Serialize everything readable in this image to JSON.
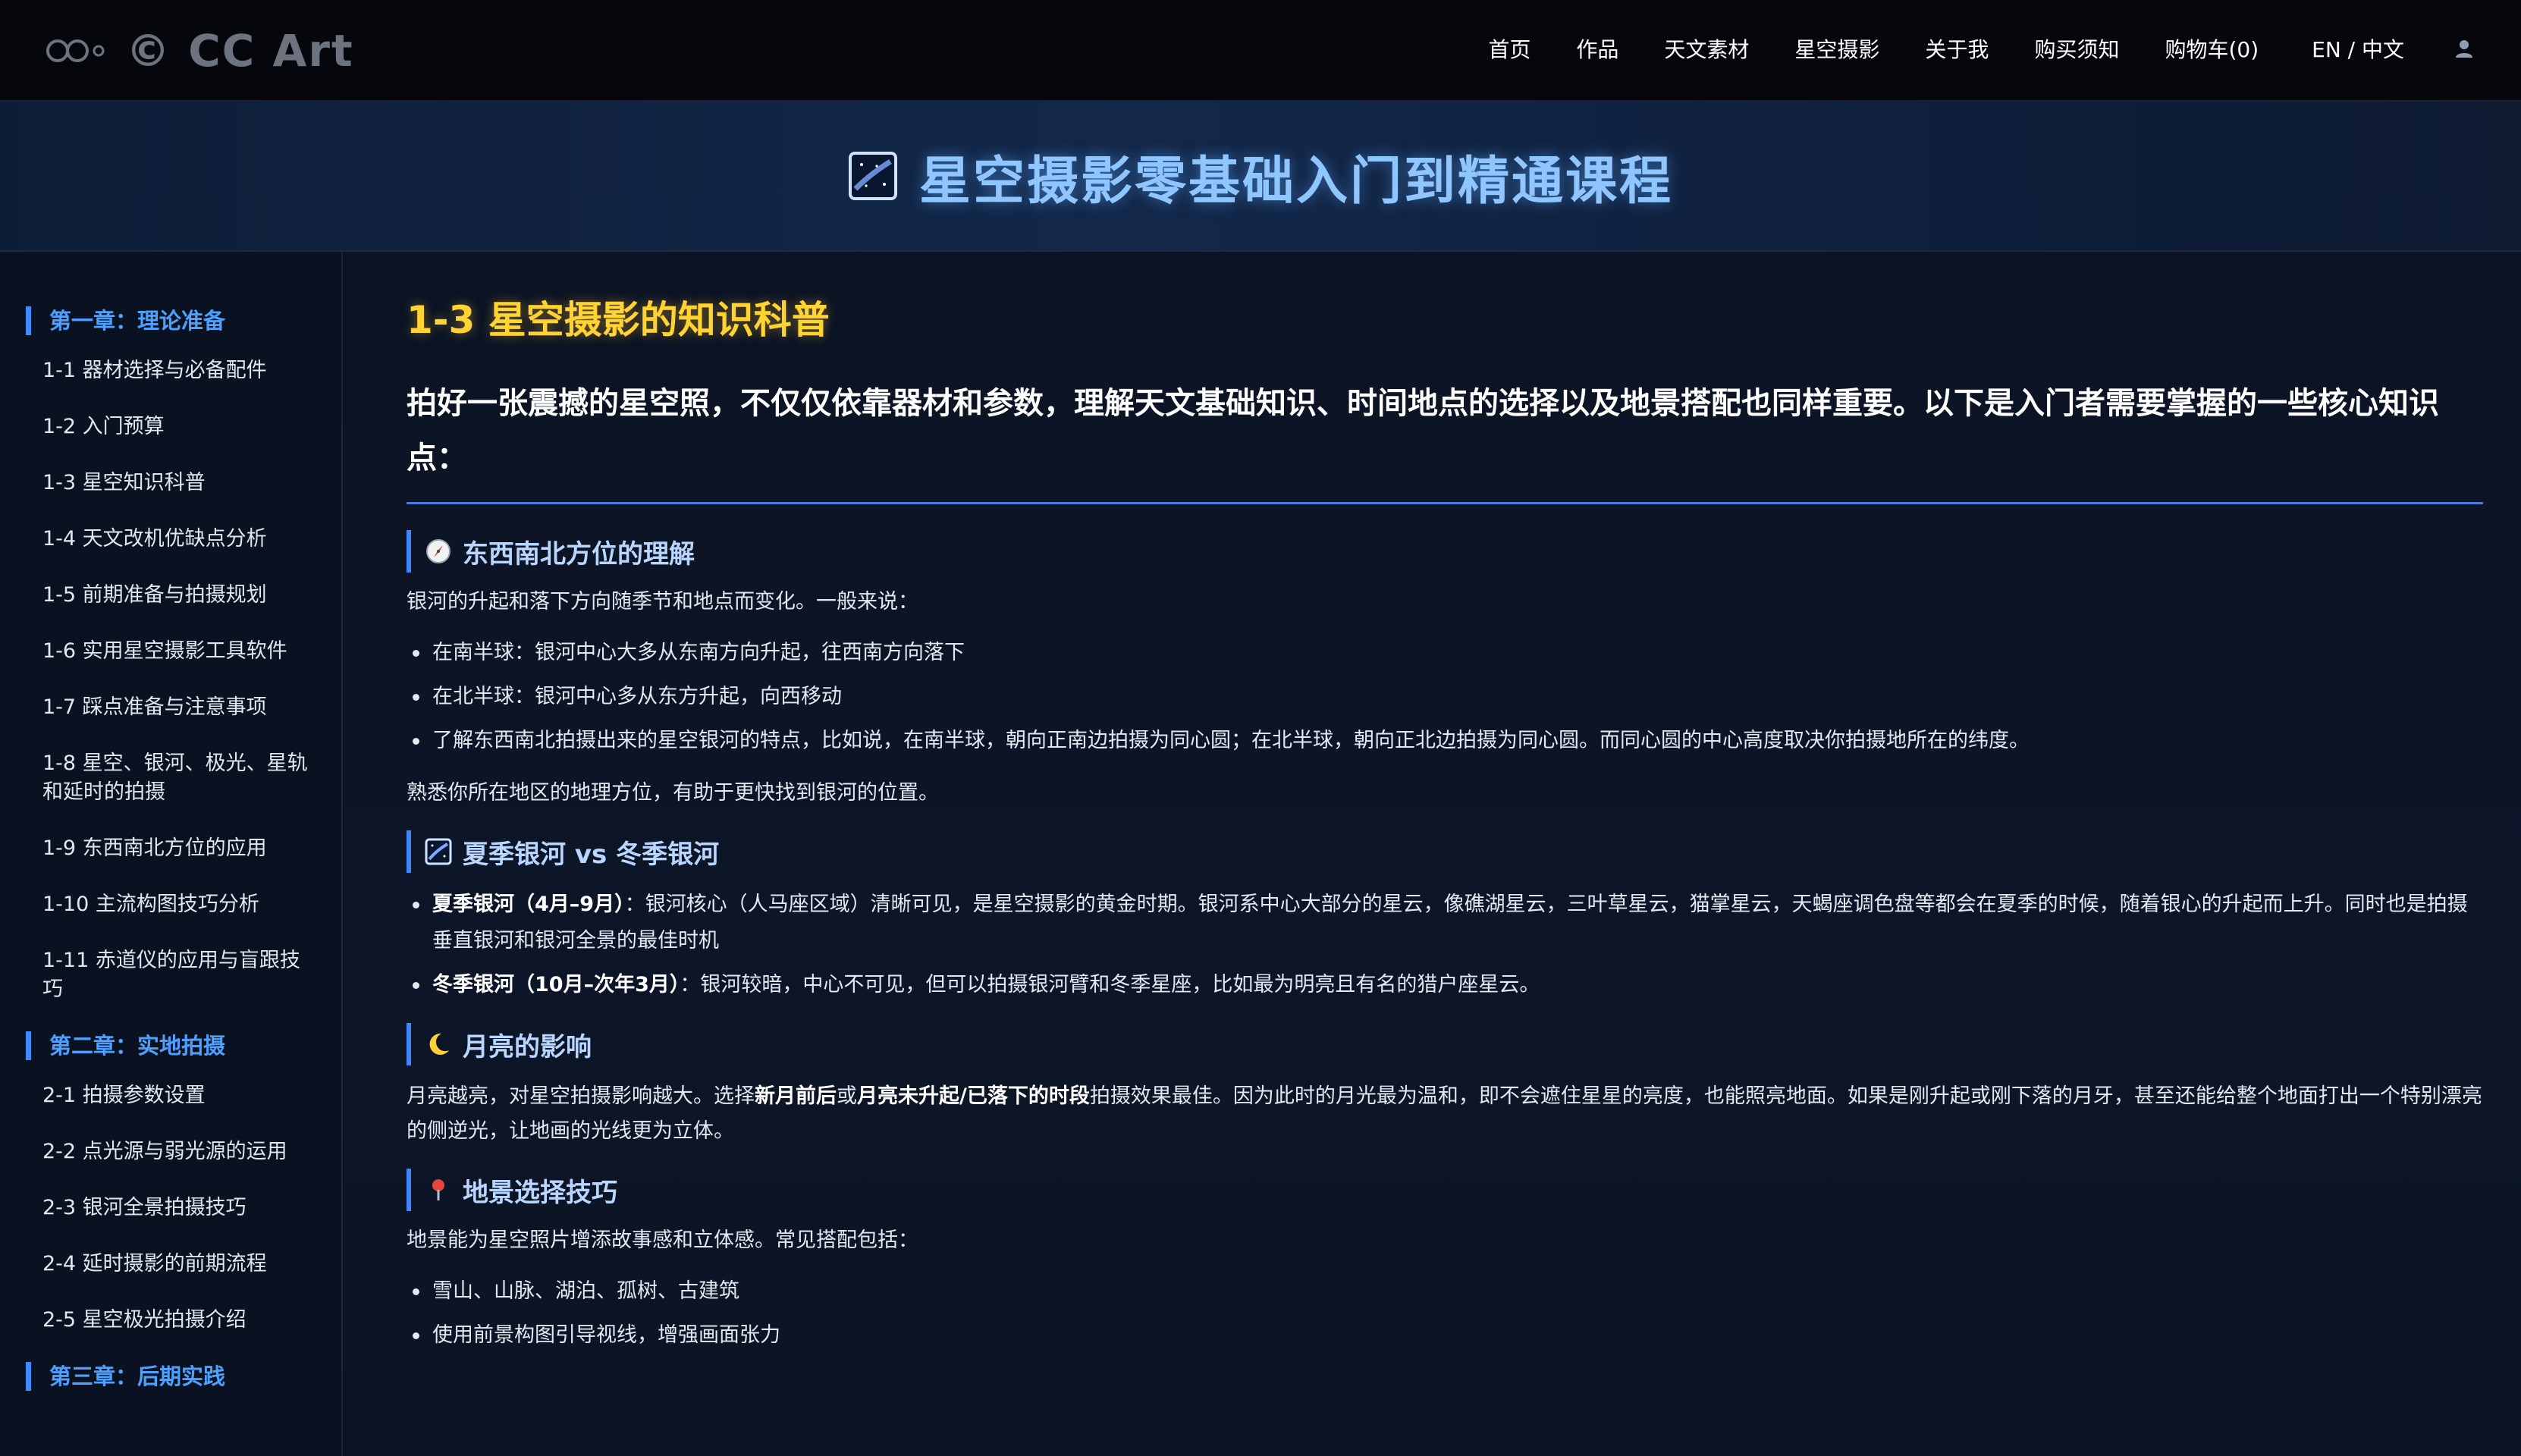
{
  "header": {
    "brand": "© CC Art",
    "nav": [
      "首页",
      "作品",
      "天文素材",
      "星空摄影",
      "关于我",
      "购买须知",
      "购物车(0)",
      "EN / 中文"
    ],
    "user_icon": "user-icon"
  },
  "banner": {
    "icon": "milky-way-icon",
    "title": "星空摄影零基础入门到精通课程"
  },
  "sidebar": {
    "ch1": "第一章：理论准备",
    "ch1_items": [
      "1-1 器材选择与必备配件",
      "1-2 入门预算",
      "1-3 星空知识科普",
      "1-4 天文改机优缺点分析",
      "1-5 前期准备与拍摄规划",
      "1-6 实用星空摄影工具软件",
      "1-7 踩点准备与注意事项",
      "1-8 星空、银河、极光、星轨和延时的拍摄",
      "1-9 东西南北方位的应用",
      "1-10 主流构图技巧分析",
      "1-11 赤道仪的应用与盲跟技巧"
    ],
    "ch2": "第二章：实地拍摄",
    "ch2_items": [
      "2-1 拍摄参数设置",
      "2-2 点光源与弱光源的运用",
      "2-3 银河全景拍摄技巧",
      "2-4 延时摄影的前期流程",
      "2-5 星空极光拍摄介绍"
    ],
    "ch3": "第三章：后期实践"
  },
  "main": {
    "title": "1-3 星空摄影的知识科普",
    "lead": "拍好一张震撼的星空照，不仅仅依靠器材和参数，理解天文基础知识、时间地点的选择以及地景搭配也同样重要。以下是入门者需要掌握的一些核心知识点：",
    "s1": {
      "icon": "compass-icon",
      "heading": "东西南北方位的理解",
      "intro": "银河的升起和落下方向随季节和地点而变化。一般来说：",
      "bullets": [
        "在南半球：银河中心大多从东南方向升起，往西南方向落下",
        "在北半球：银河中心多从东方升起，向西移动",
        "了解东西南北拍摄出来的星空银河的特点，比如说，在南半球，朝向正南边拍摄为同心圆；在北半球，朝向正北边拍摄为同心圆。而同心圆的中心高度取决你拍摄地所在的纬度。"
      ],
      "outro": "熟悉你所在地区的地理方位，有助于更快找到银河的位置。"
    },
    "s2": {
      "icon": "milky-way-icon",
      "heading": "夏季银河 vs 冬季银河",
      "b1_label": "夏季银河（4月–9月）",
      "b1_text": "：银河核心（人马座区域）清晰可见，是星空摄影的黄金时期。银河系中心大部分的星云，像礁湖星云，三叶草星云，猫掌星云，天蝎座调色盘等都会在夏季的时候，随着银心的升起而上升。同时也是拍摄垂直银河和银河全景的最佳时机",
      "b2_label": "冬季银河（10月–次年3月）",
      "b2_text": "：银河较暗，中心不可见，但可以拍摄银河臂和冬季星座，比如最为明亮且有名的猎户座星云。"
    },
    "s3": {
      "icon": "crescent-moon-icon",
      "heading": "月亮的影响",
      "p_a": "月亮越亮，对星空拍摄影响越大。选择",
      "p_b1": "新月前后",
      "p_c": "或",
      "p_b2": "月亮未升起/已落下的时段",
      "p_d": "拍摄效果最佳。因为此时的月光最为温和，即不会遮住星星的亮度，也能照亮地面。如果是刚升起或刚下落的月牙，甚至还能给整个地面打出一个特别漂亮的侧逆光，让地画的光线更为立体。"
    },
    "s4": {
      "icon": "pin-icon",
      "heading": "地景选择技巧",
      "intro": "地景能为星空照片增添故事感和立体感。常见搭配包括：",
      "bullets": [
        "雪山、山脉、湖泊、孤树、古建筑",
        "使用前景构图引导视线，增强画面张力"
      ]
    }
  },
  "colors": {
    "accent_blue": "#3d8bff",
    "title_gold": "#ffd332",
    "banner_title": "#8fc6ff",
    "background": "#0b1120"
  }
}
